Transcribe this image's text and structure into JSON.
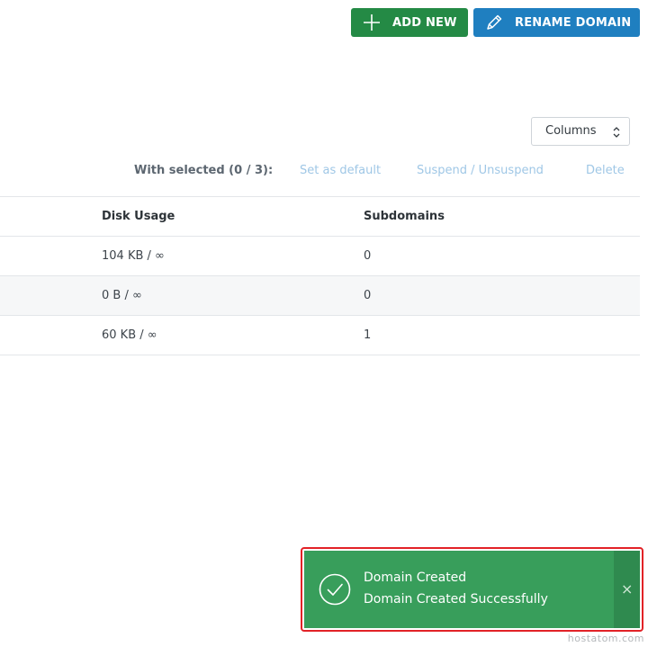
{
  "toolbar": {
    "add_new_label": "ADD NEW",
    "rename_domain_label": "RENAME DOMAIN"
  },
  "columns_select": {
    "label": "Columns"
  },
  "bulk_actions": {
    "label": "With selected (0 / 3):",
    "set_default": "Set as default",
    "suspend_unsuspend": "Suspend / Unsuspend",
    "delete": "Delete"
  },
  "table": {
    "headers": [
      "Disk Usage",
      "Subdomains"
    ],
    "rows": [
      {
        "disk_usage": "104 KB / ∞",
        "subdomains": "0"
      },
      {
        "disk_usage": "0 B / ∞",
        "subdomains": "0"
      },
      {
        "disk_usage": "60 KB / ∞",
        "subdomains": "1"
      }
    ]
  },
  "toast": {
    "title": "Domain Created",
    "message": "Domain Created Successfully",
    "close_glyph": "×",
    "background_color": "#389e5b"
  },
  "watermark": "hostatom.com",
  "colors": {
    "add_button": "#248a45",
    "rename_button": "#1f7fc0",
    "link_disabled": "#9fc7e6"
  }
}
